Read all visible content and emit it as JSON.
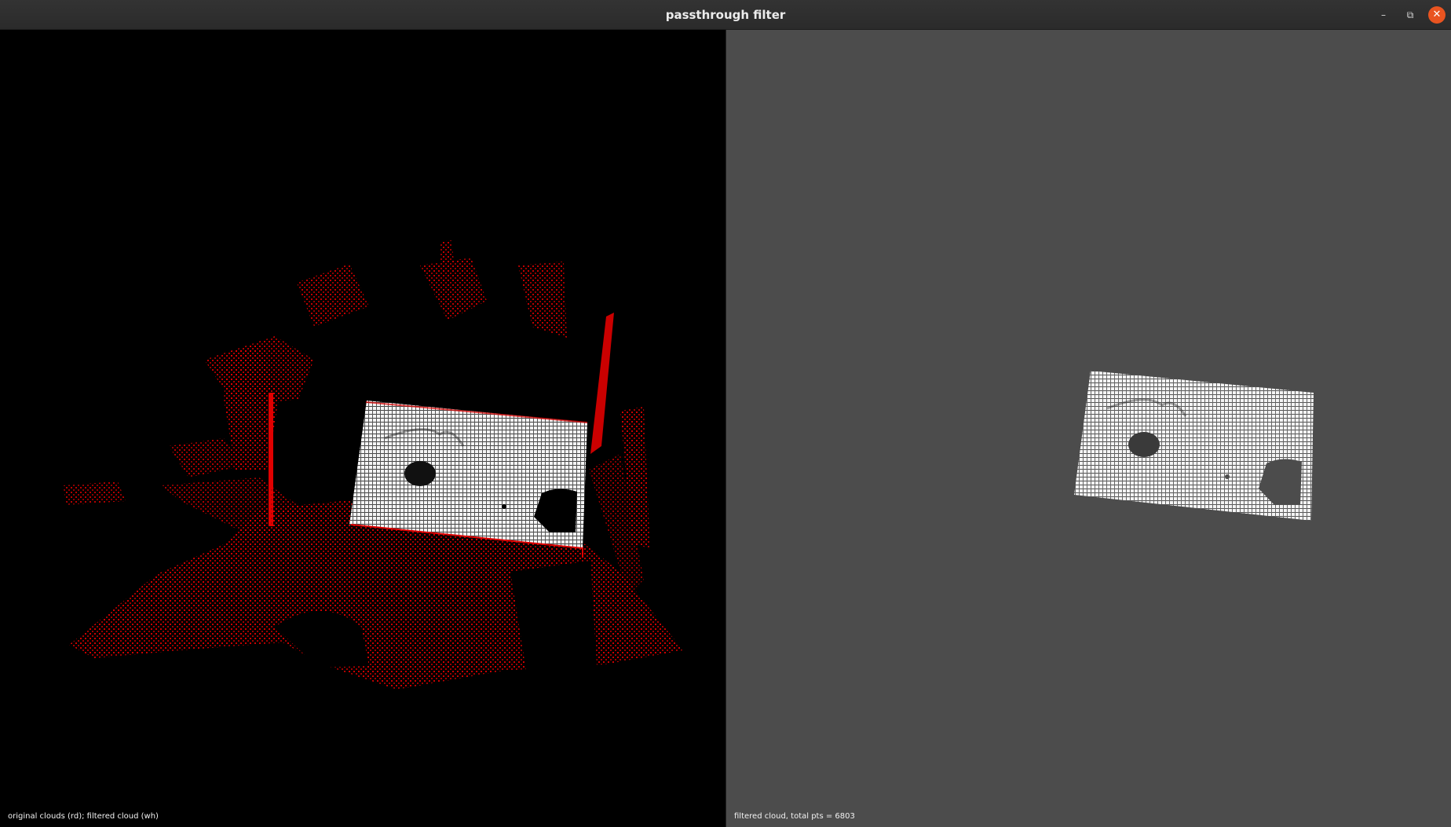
{
  "window": {
    "title": "passthrough filter",
    "controls": {
      "minimize": "–",
      "maximize": "⧉",
      "close": "✕"
    }
  },
  "viewports": {
    "left": {
      "label": "original clouds (rd); filtered cloud (wh)",
      "background": "#000000"
    },
    "right": {
      "label": "filtered cloud, total pts = 6803",
      "background": "#4c4c4c"
    }
  },
  "colors": {
    "original_cloud": "#e00000",
    "filtered_cloud": "#ffffff",
    "close_button": "#e95420"
  }
}
